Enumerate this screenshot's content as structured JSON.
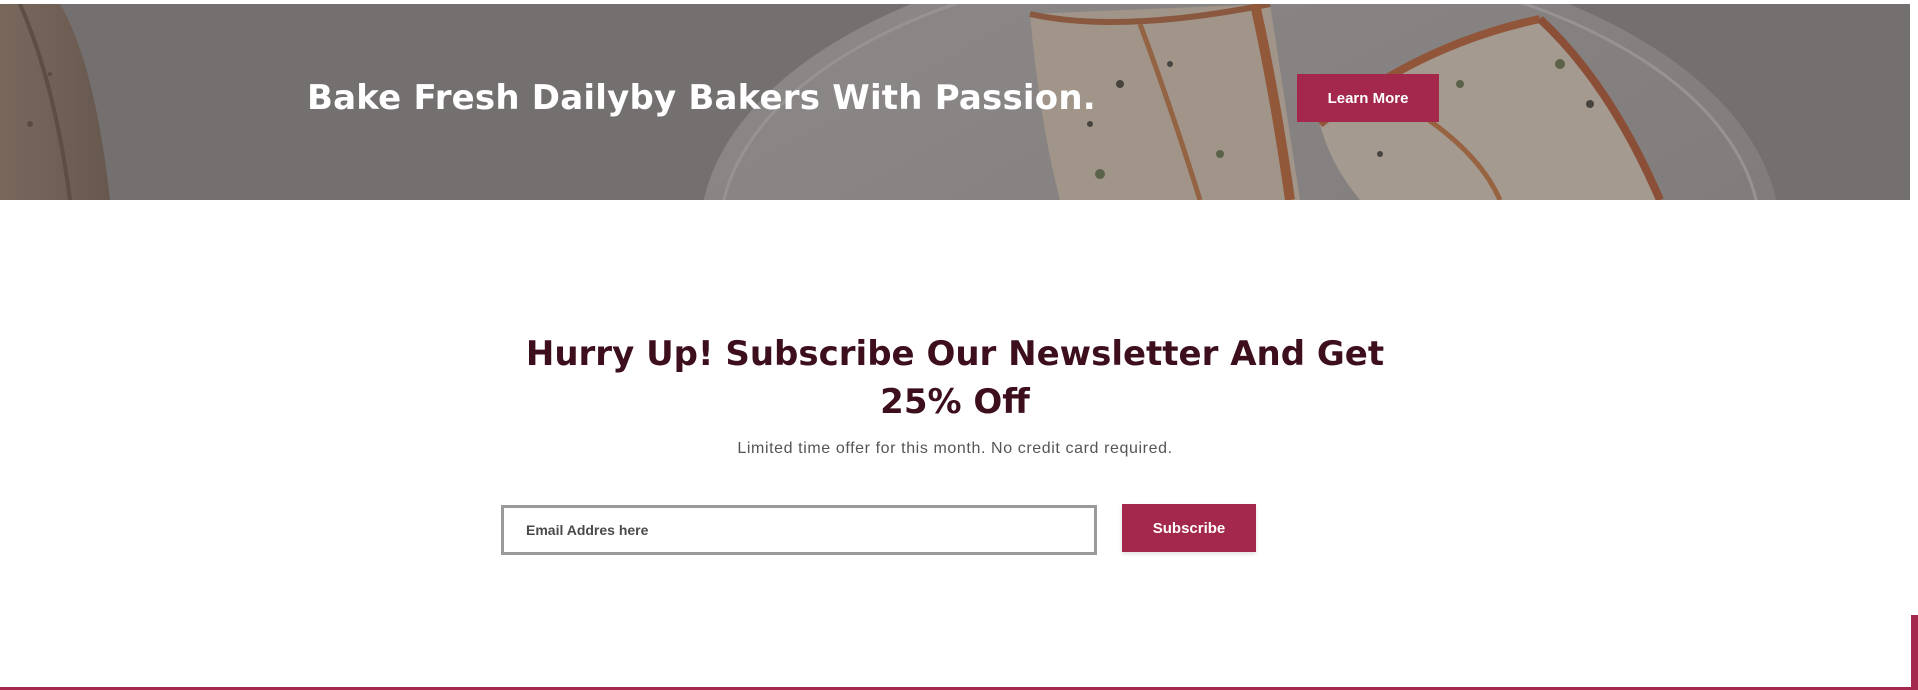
{
  "hero": {
    "title": "Bake Fresh Dailyby Bakers With Passion.",
    "button_label": "Learn More",
    "image_icon": "pizza-slices-on-plate"
  },
  "newsletter": {
    "title": "Hurry Up! Subscribe Our Newsletter And Get 25% Off",
    "subtitle": "Limited time offer for this month. No credit card required.",
    "email_placeholder": "Email Addres here",
    "email_value": "",
    "subscribe_label": "Subscribe"
  },
  "colors": {
    "accent": "#a3284b",
    "heading": "#3d0f1c",
    "body_text": "#555555",
    "hero_overlay": "#8a8685"
  }
}
